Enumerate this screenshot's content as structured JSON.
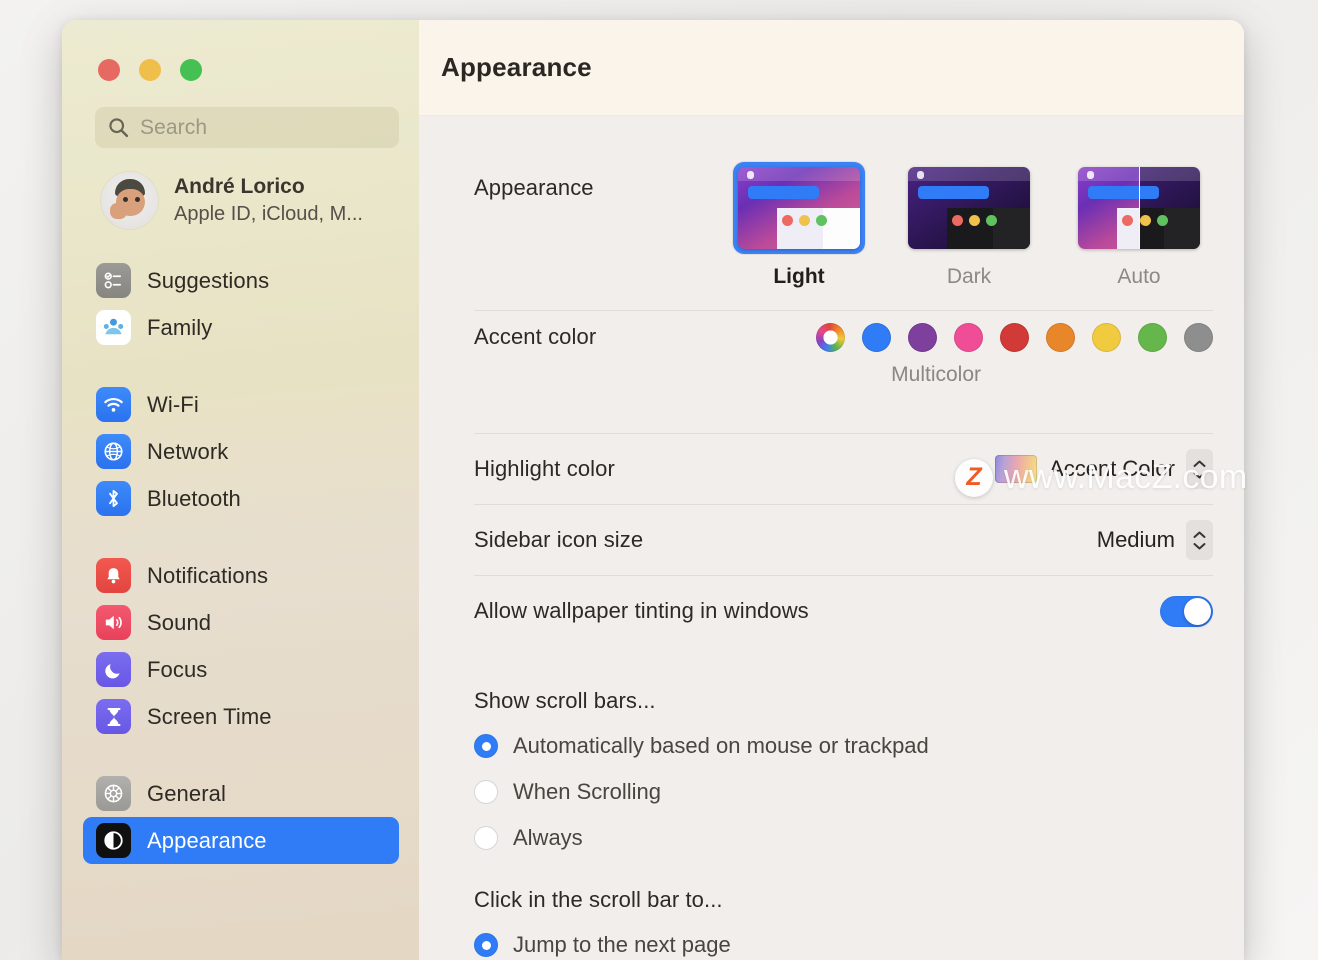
{
  "window": {
    "traffic_lights": [
      {
        "name": "close",
        "color": "#e66a62"
      },
      {
        "name": "minimize",
        "color": "#f0be4b"
      },
      {
        "name": "zoom",
        "color": "#45c052"
      }
    ]
  },
  "sidebar": {
    "search": {
      "placeholder": "Search",
      "icon": "search-icon"
    },
    "profile": {
      "name": "André Lorico",
      "subtitle": "Apple ID, iCloud, M...",
      "avatar_icon": "memoji-avatar"
    },
    "groups": [
      {
        "items": [
          {
            "label": "Suggestions",
            "icon": "suggestions-icon",
            "selected": false
          },
          {
            "label": "Family",
            "icon": "family-icon",
            "selected": false
          }
        ]
      },
      {
        "items": [
          {
            "label": "Wi-Fi",
            "icon": "wifi-icon",
            "selected": false
          },
          {
            "label": "Network",
            "icon": "network-globe-icon",
            "selected": false
          },
          {
            "label": "Bluetooth",
            "icon": "bluetooth-icon",
            "selected": false
          }
        ]
      },
      {
        "items": [
          {
            "label": "Notifications",
            "icon": "notifications-bell-icon",
            "selected": false
          },
          {
            "label": "Sound",
            "icon": "sound-speaker-icon",
            "selected": false
          },
          {
            "label": "Focus",
            "icon": "focus-moon-icon",
            "selected": false
          },
          {
            "label": "Screen Time",
            "icon": "screen-time-hourglass-icon",
            "selected": false
          }
        ]
      },
      {
        "items": [
          {
            "label": "General",
            "icon": "general-gear-icon",
            "selected": false
          },
          {
            "label": "Appearance",
            "icon": "appearance-contrast-icon",
            "selected": true
          }
        ]
      }
    ]
  },
  "header": {
    "title": "Appearance"
  },
  "main": {
    "appearance_row": {
      "label": "Appearance",
      "modes": [
        {
          "name": "Light",
          "selected": true
        },
        {
          "name": "Dark",
          "selected": false
        },
        {
          "name": "Auto",
          "selected": false
        }
      ]
    },
    "accent_row": {
      "label": "Accent color",
      "caption": "Multicolor",
      "swatches": [
        {
          "name": "multicolor",
          "color": "multicolor"
        },
        {
          "name": "blue",
          "color": "#2f7cf6"
        },
        {
          "name": "purple",
          "color": "#7e3f9d"
        },
        {
          "name": "pink",
          "color": "#ef4e96"
        },
        {
          "name": "red",
          "color": "#d13a36"
        },
        {
          "name": "orange",
          "color": "#e8862a"
        },
        {
          "name": "yellow",
          "color": "#f0ca3f"
        },
        {
          "name": "green",
          "color": "#66b košt"
        },
        {
          "name": "graphite",
          "color": "#8e8e8e"
        }
      ]
    },
    "highlight_row": {
      "label": "Highlight color",
      "value": "Accent Color"
    },
    "sidebar_icon_size_row": {
      "label": "Sidebar icon size",
      "value": "Medium"
    },
    "wallpaper_tint_row": {
      "label": "Allow wallpaper tinting in windows",
      "enabled": true
    },
    "scroll_bars_group": {
      "title": "Show scroll bars...",
      "options": [
        {
          "label": "Automatically based on mouse or trackpad",
          "selected": true
        },
        {
          "label": "When Scrolling",
          "selected": false
        },
        {
          "label": "Always",
          "selected": false
        }
      ]
    },
    "scroll_click_group": {
      "title": "Click in the scroll bar to...",
      "options": [
        {
          "label": "Jump to the next page",
          "selected": true
        }
      ]
    }
  },
  "watermark": {
    "badge": "Z",
    "text": "www.MacZ.com"
  },
  "colors": {
    "accent": "#2f7cf6",
    "sidebar_selected": "#2f7cf6",
    "panel_bg": "#f1eeeb",
    "titlebar_bg": "#fbf4ea"
  }
}
